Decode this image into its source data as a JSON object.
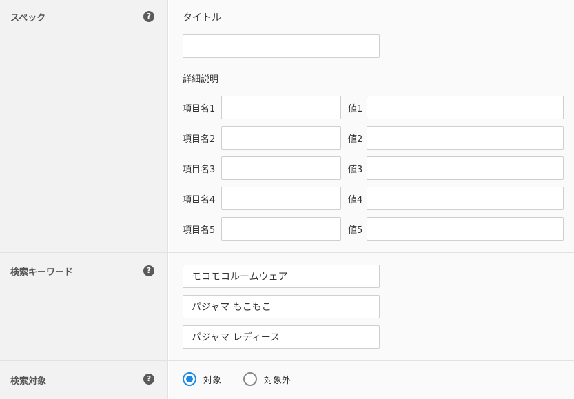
{
  "spec": {
    "label": "スペック",
    "help_icon": "?",
    "title_label": "タイトル",
    "title_value": "",
    "detail_label": "詳細説明",
    "items": [
      {
        "name_label": "項目名1",
        "name_value": "",
        "value_label": "値1",
        "value_value": ""
      },
      {
        "name_label": "項目名2",
        "name_value": "",
        "value_label": "値2",
        "value_value": ""
      },
      {
        "name_label": "項目名3",
        "name_value": "",
        "value_label": "値3",
        "value_value": ""
      },
      {
        "name_label": "項目名4",
        "name_value": "",
        "value_label": "値4",
        "value_value": ""
      },
      {
        "name_label": "項目名5",
        "name_value": "",
        "value_label": "値5",
        "value_value": ""
      }
    ]
  },
  "keywords": {
    "label": "検索キーワード",
    "help_icon": "?",
    "values": [
      "モコモコルームウェア",
      "パジャマ もこもこ",
      "パジャマ レディース"
    ]
  },
  "search_target": {
    "label": "検索対象",
    "help_icon": "?",
    "options": [
      {
        "label": "対象",
        "checked": true
      },
      {
        "label": "対象外",
        "checked": false
      }
    ]
  },
  "colors": {
    "accent": "#1e88e5",
    "label_bg": "#f2f2f2",
    "value_bg": "#fafafa"
  }
}
